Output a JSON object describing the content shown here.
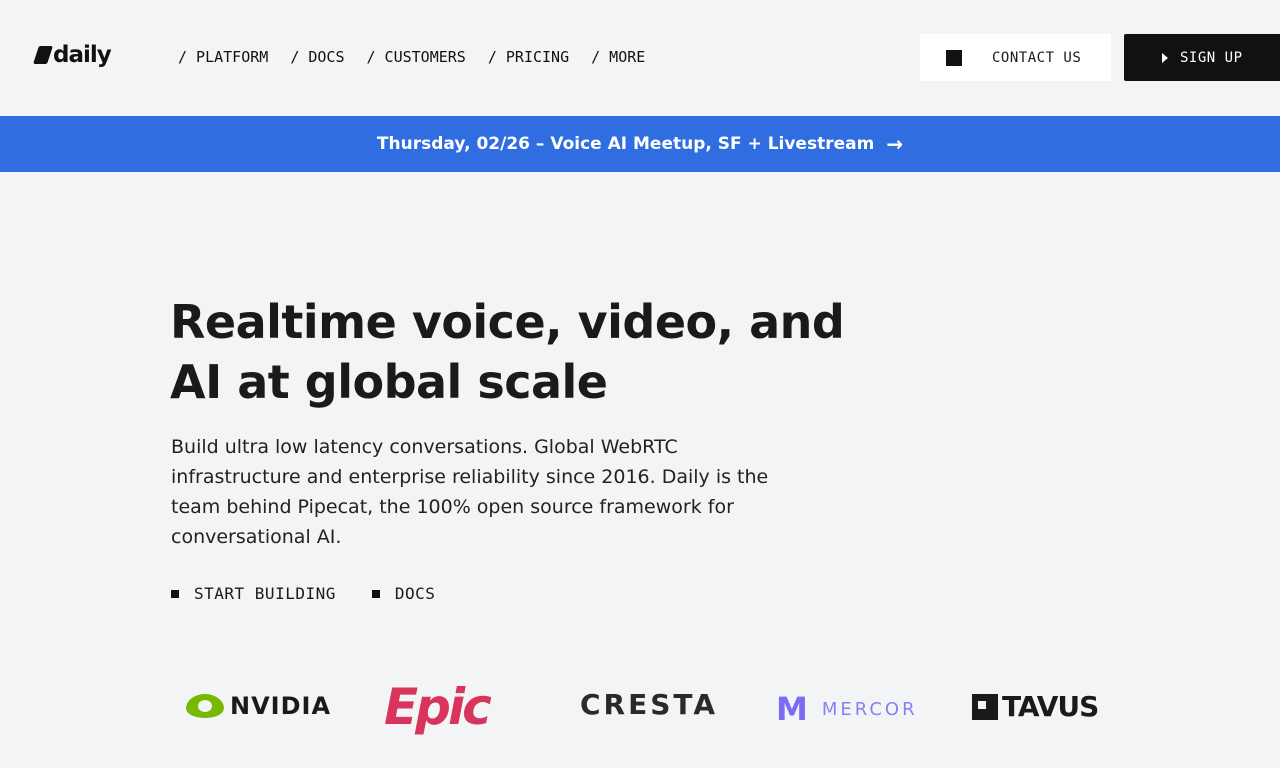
{
  "header": {
    "logo_text": "daily",
    "nav": [
      "/ PLATFORM",
      "/ DOCS",
      "/ CUSTOMERS",
      "/ PRICING",
      "/ MORE"
    ],
    "contact_label": "CONTACT US",
    "signup_label": "SIGN UP"
  },
  "banner": {
    "text": "Thursday, 02/26 – Voice AI Meetup, SF + Livestream",
    "arrow": "→"
  },
  "hero": {
    "title_line1": "Realtime voice, video, and",
    "title_line2": "AI at global scale",
    "description": "Build ultra low latency conversations. Global WebRTC infrastructure and enterprise reliability since 2016. Daily is the team behind Pipecat, the 100% open source framework for conversational AI.",
    "cta_primary": "START BUILDING",
    "cta_secondary": "DOCS"
  },
  "customers": {
    "nvidia": "NVIDIA",
    "epic": "Epic",
    "cresta": "CRESTA",
    "mercor_mark": "M",
    "mercor": "MERCOR",
    "tavus": "TAVUS"
  },
  "colors": {
    "banner_bg": "#2f6de1",
    "nvidia_green": "#76b900",
    "epic_red": "#d9345c",
    "mercor_purple": "#7c6cf2",
    "page_bg": "#f3f4f6"
  }
}
